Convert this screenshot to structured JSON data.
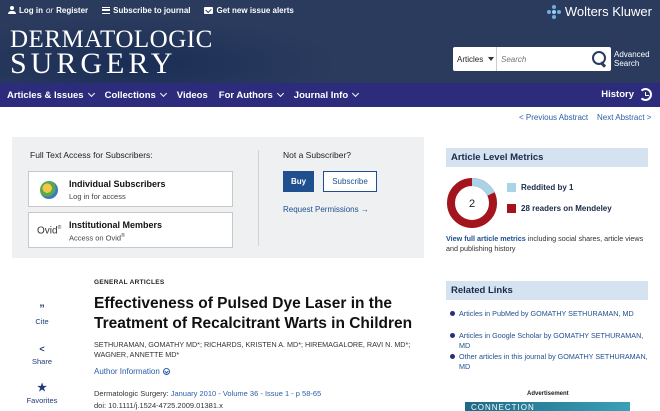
{
  "header": {
    "login_label": "Log in",
    "or_label": "or",
    "register_label": "Register",
    "subscribe_label": "Subscribe to journal",
    "alerts_label": "Get new issue alerts",
    "publisher": "Wolters Kluwer",
    "journal_line1": "DERMATOLOGIC",
    "journal_line2": "SURGERY",
    "search_scope": "Articles",
    "search_placeholder": "Search",
    "advanced_search": "Advanced Search"
  },
  "nav": {
    "items": [
      "Articles & Issues",
      "Collections",
      "Videos",
      "For Authors",
      "Journal Info"
    ],
    "history": "History"
  },
  "abstract_nav": {
    "prev": "< Previous Abstract",
    "next": "Next Abstract >"
  },
  "access": {
    "title": "Full Text Access for Subscribers:",
    "individual_label": "Individual Subscribers",
    "individual_sub": "Log in for access",
    "ovid_logo": "Ovid",
    "institutional_label": "Institutional Members",
    "institutional_sub": "Access on Ovid",
    "not_subscriber": "Not a Subscriber?",
    "buy": "Buy",
    "subscribe": "Subscribe",
    "request_permissions": "Request Permissions"
  },
  "actions": {
    "cite": "Cite",
    "share": "Share",
    "favorites": "Favorites"
  },
  "article": {
    "category": "GENERAL ARTICLES",
    "title": "Effectiveness of Pulsed Dye Laser in the Treatment of Recalcitrant Warts in Children",
    "authors": "SETHURAMAN, GOMATHY MD*; RICHARDS, KRISTEN A. MD*; HIREMAGALORE, RAVI N. MD*; WAGNER, ANNETTE MD*",
    "author_info": "Author Information",
    "journal": "Dermatologic Surgery:",
    "citation_link": "January 2010 - Volume 36 - Issue 1 - p 58-65",
    "doi": "doi: 10.1111/j.1524-4725.2009.01381.x"
  },
  "metrics": {
    "heading": "Article Level Metrics",
    "score": "2",
    "reddit": "Reddited by 1",
    "mendeley": "28 readers on Mendeley",
    "reddit_color": "#a9d4e8",
    "mendeley_color": "#a3141c",
    "view_full_link": "View full article metrics",
    "view_full_rest": " including social shares, article views and publishing history"
  },
  "related": {
    "heading": "Related Links",
    "links": [
      "Articles in PubMed by GOMATHY SETHURAMAN, MD",
      "Articles in Google Scholar by GOMATHY SETHURAMAN, MD",
      "Other articles in this journal by GOMATHY SETHURAMAN, MD"
    ]
  },
  "advertisement": {
    "label": "Advertisement",
    "banner_text": "CONNECTION"
  },
  "icons": [
    "user-icon",
    "menu-lines-icon",
    "mail-icon",
    "search-icon",
    "history-icon",
    "quote-icon",
    "share-icon",
    "star-icon",
    "globe-icon",
    "arrow-right-icon",
    "chevron-down-icon"
  ]
}
